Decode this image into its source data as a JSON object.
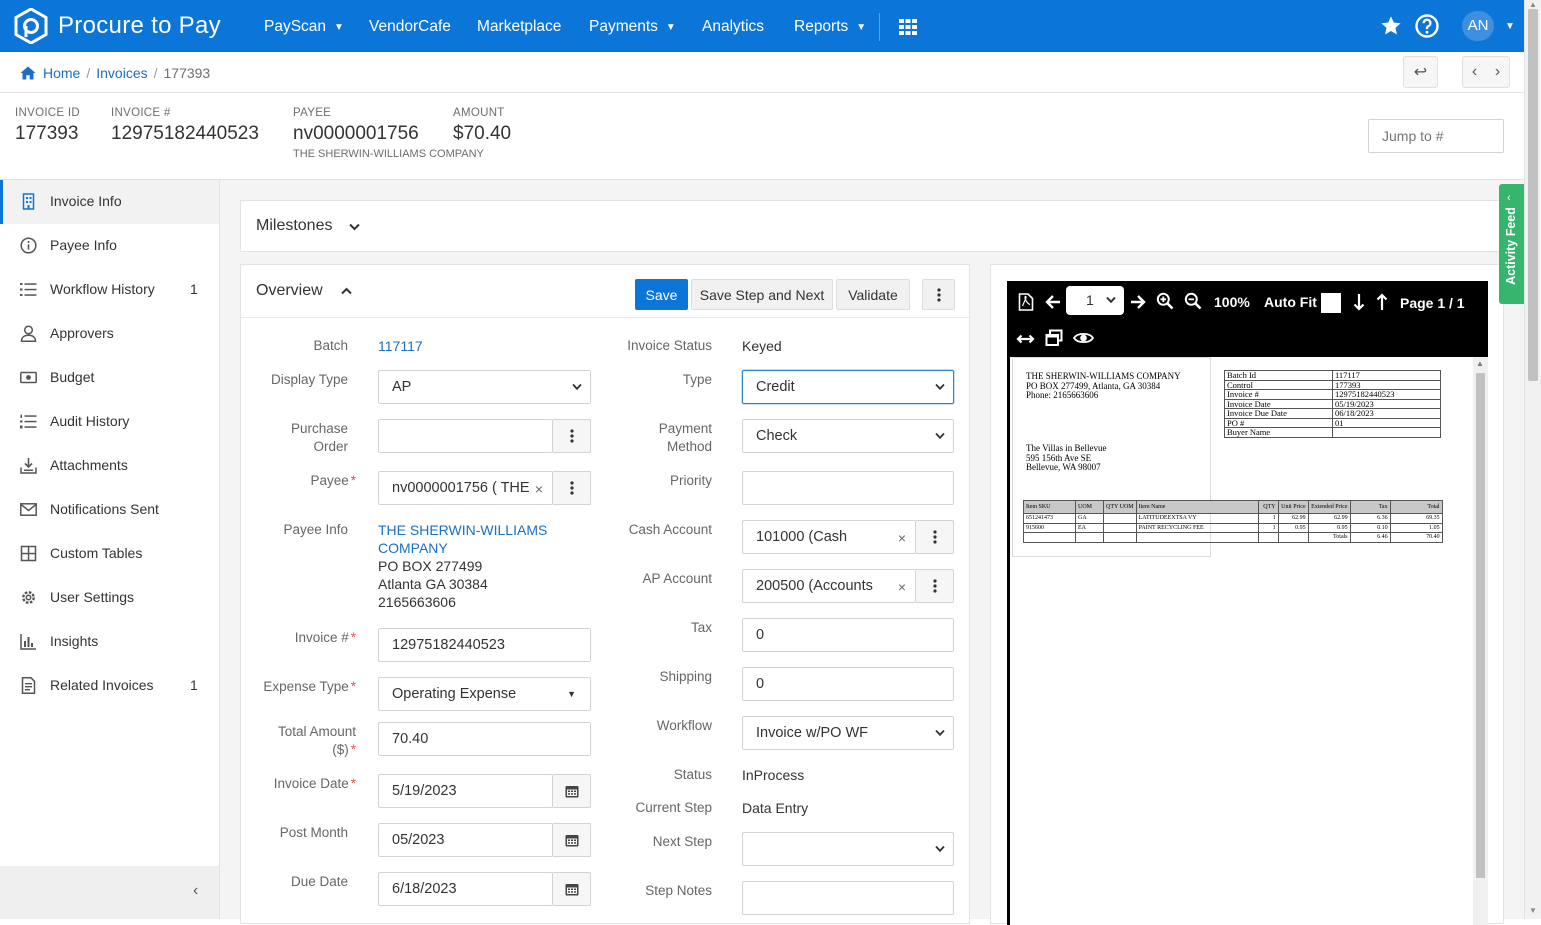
{
  "nav": {
    "brand": "Procure to Pay",
    "items": [
      "PayScan",
      "VendorCafe",
      "Marketplace",
      "Payments",
      "Analytics",
      "Reports"
    ],
    "avatar": "AN",
    "icons": [
      "apps-grid-icon",
      "star-icon",
      "help-icon"
    ]
  },
  "breadcrumb": {
    "home": "Home",
    "sep": "/",
    "invoices": "Invoices",
    "current": "177393"
  },
  "summary": {
    "invoice_id_label": "INVOICE ID",
    "invoice_id": "177393",
    "invoice_no_label": "INVOICE #",
    "invoice_no": "12975182440523",
    "payee_label": "PAYEE",
    "payee": "nv0000001756",
    "payee_name": "THE SHERWIN-WILLIAMS COMPANY",
    "amount_label": "AMOUNT",
    "amount": "$70.40",
    "jump_placeholder": "Jump to #"
  },
  "sidebar": {
    "items": [
      {
        "label": "Invoice Info",
        "count": ""
      },
      {
        "label": "Payee Info",
        "count": ""
      },
      {
        "label": "Workflow History",
        "count": "1"
      },
      {
        "label": "Approvers",
        "count": ""
      },
      {
        "label": "Budget",
        "count": ""
      },
      {
        "label": "Audit History",
        "count": ""
      },
      {
        "label": "Attachments",
        "count": ""
      },
      {
        "label": "Notifications Sent",
        "count": ""
      },
      {
        "label": "Custom Tables",
        "count": ""
      },
      {
        "label": "User Settings",
        "count": ""
      },
      {
        "label": "Insights",
        "count": ""
      },
      {
        "label": "Related Invoices",
        "count": "1"
      }
    ],
    "collapse": "‹"
  },
  "milestones": {
    "title": "Milestones"
  },
  "overview": {
    "title": "Overview",
    "save": "Save",
    "save_next": "Save Step and Next",
    "validate": "Validate",
    "left": {
      "batch_label": "Batch",
      "batch": "117117",
      "display_type_label": "Display Type",
      "display_type": "AP",
      "po_label_1": "Purchase",
      "po_label_2": "Order",
      "po": "",
      "payee_label": "Payee",
      "payee": "nv0000001756 ( THE",
      "payee_info_label": "Payee Info",
      "payee_info_name_1": "THE SHERWIN-WILLIAMS",
      "payee_info_name_2": "COMPANY",
      "payee_info_addr1": "PO BOX 277499",
      "payee_info_addr2": "Atlanta GA 30384",
      "payee_info_phone": "2165663606",
      "invoice_no_label": "Invoice #",
      "invoice_no": "12975182440523",
      "expense_type_label": "Expense Type",
      "expense_type": "Operating Expense",
      "total_label_1": "Total Amount",
      "total_label_2": "($)",
      "total": "70.40",
      "invoice_date_label": "Invoice Date",
      "invoice_date": "5/19/2023",
      "post_month_label": "Post Month",
      "post_month": "05/2023",
      "due_date_label": "Due Date",
      "due_date": "6/18/2023"
    },
    "right": {
      "status_label": "Invoice Status",
      "status": "Keyed",
      "type_label": "Type",
      "type": "Credit",
      "pm_label_1": "Payment",
      "pm_label_2": "Method",
      "payment_method": "Check",
      "priority_label": "Priority",
      "priority": "",
      "cash_label": "Cash Account",
      "cash": "101000 (Cash",
      "ap_label": "AP Account",
      "ap": "200500 (Accounts",
      "tax_label": "Tax",
      "tax": "0",
      "shipping_label": "Shipping",
      "shipping": "0",
      "workflow_label": "Workflow",
      "workflow": "Invoice w/PO WF",
      "wstatus_label": "Status",
      "wstatus": "InProcess",
      "step_label": "Current Step",
      "step": "Data Entry",
      "next_label": "Next Step",
      "next": "",
      "notes_label": "Step Notes",
      "notes": ""
    }
  },
  "viewer": {
    "page_sel": "1",
    "zoom": "100%",
    "autofit": "Auto Fit",
    "page": "Page 1 / 1",
    "doc": {
      "vendor": "THE SHERWIN-WILLIAMS COMPANY",
      "vendor_addr": "PO BOX 277499,  Atlanta, GA  30384",
      "vendor_phone": "Phone: 2165663606",
      "bill_1": "The Villas in Bellevue",
      "bill_2": "595 156th Ave SE",
      "bill_3": "Bellevue, WA 98007",
      "meta": [
        [
          "Batch Id",
          "117117"
        ],
        [
          "Control",
          "177393"
        ],
        [
          "Invoice #",
          "12975182440523"
        ],
        [
          "Invoice Date",
          "05/19/2023"
        ],
        [
          "Invoice Due Date",
          "06/18/2023"
        ],
        [
          "PO #",
          "01"
        ],
        [
          "Buyer Name",
          ""
        ]
      ],
      "line_headers": [
        "Item SKU",
        "UOM",
        "QTY UOM",
        "Item Name",
        "QTY",
        "Unit Price",
        "Extended Price",
        "Tax",
        "Total"
      ],
      "lines": [
        [
          "651241473",
          "GA",
          "",
          "LATITUDEEXTSA VY",
          "1",
          "62.99",
          "62.99",
          "6.36",
          "69.35"
        ],
        [
          "915600",
          "EA",
          "",
          "PAINT RECYCLING FEE",
          "1",
          "0.95",
          "0.95",
          "0.10",
          "1.05"
        ]
      ],
      "totals_label": "Totals",
      "totals_tax": "6.46",
      "totals_total": "70.40"
    }
  },
  "activity_feed": "Activity Feed",
  "colors": {
    "primary": "#0b75d8",
    "link": "#1a6fc4",
    "activity": "#35b56e",
    "required": "#d9534f"
  }
}
